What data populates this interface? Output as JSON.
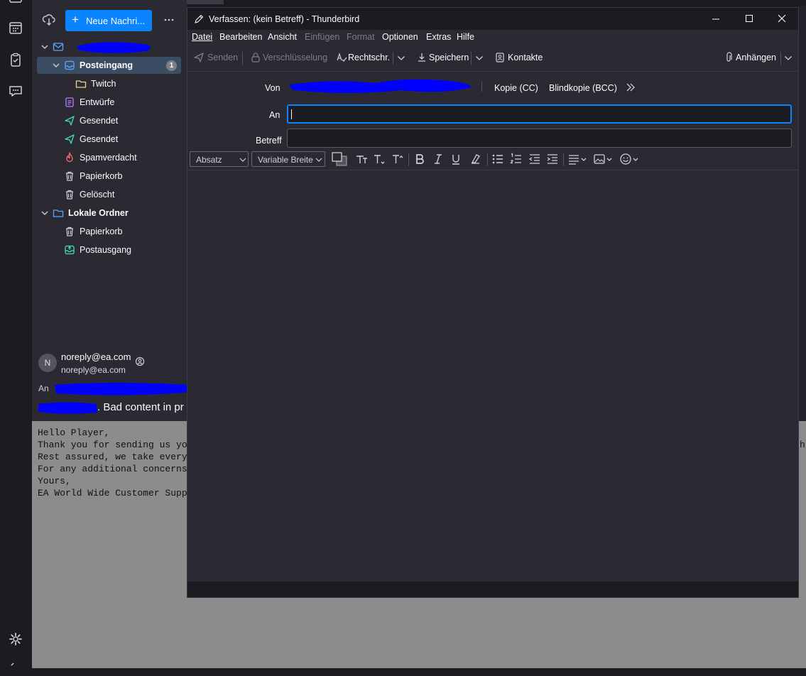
{
  "folder_pane": {
    "new_message_label": "Neue Nachri...",
    "folders": [
      {
        "label": "Posteingang",
        "badge": "1"
      },
      {
        "label": "Twitch"
      },
      {
        "label": "Entwürfe"
      },
      {
        "label": "Gesendet"
      },
      {
        "label": "Gesendet"
      },
      {
        "label": "Spamverdacht"
      },
      {
        "label": "Papierkorb"
      },
      {
        "label": "Gelöscht"
      }
    ],
    "local_folders": {
      "label": "Lokale Ordner",
      "folders": [
        {
          "label": "Papierkorb"
        },
        {
          "label": "Postausgang"
        }
      ]
    }
  },
  "message": {
    "avatar_letter": "N",
    "sender_name": "noreply@ea.com",
    "sender_email": "noreply@ea.com",
    "to_label": "An",
    "subject_partial": ". Bad content in pr",
    "body_lines": [
      "Hello Player,",
      "Thank you for sending us yo",
      "Rest assured, we take every",
      "For any additional concerns",
      "Yours,",
      "EA World Wide Customer Supp"
    ],
    "body_overflow_fragment": "h"
  },
  "compose": {
    "title": "Verfassen: (kein Betreff) - Thunderbird",
    "menu": [
      "Datei",
      "Bearbeiten",
      "Ansicht",
      "Einfügen",
      "Format",
      "Optionen",
      "Extras",
      "Hilfe"
    ],
    "toolbar": {
      "send": "Senden",
      "encryption": "Verschlüsselung",
      "spelling": "Rechtschr.",
      "save": "Speichern",
      "contacts": "Kontakte",
      "attach": "Anhängen"
    },
    "headers": {
      "from_label": "Von",
      "cc": "Kopie (CC)",
      "bcc": "Blindkopie (BCC)",
      "to_label": "An",
      "to_value": "",
      "subject_label": "Betreff",
      "subject_value": ""
    },
    "format": {
      "paragraph": "Absatz",
      "font": "Variable Breite"
    }
  },
  "colors": {
    "accent": "#0a84ff",
    "redaction": "#0000ff",
    "selection": "#3b4d63"
  }
}
